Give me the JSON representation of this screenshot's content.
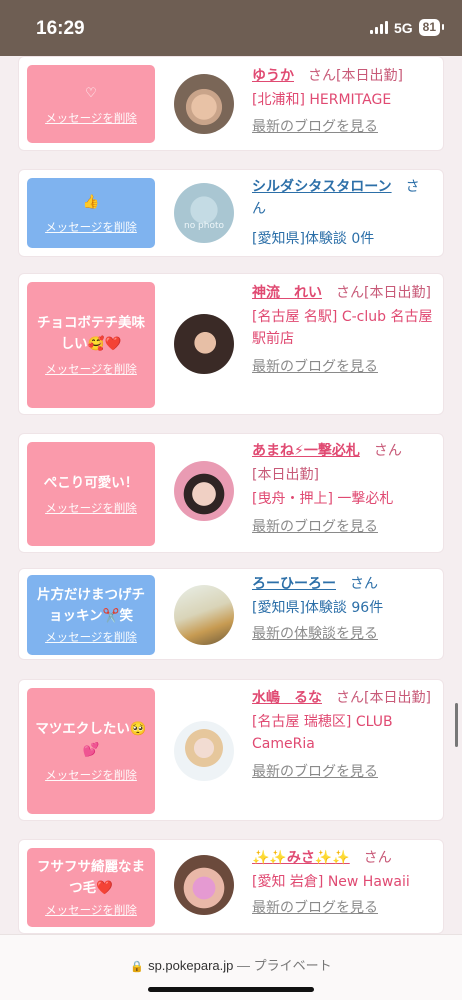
{
  "status_bar": {
    "time": "16:29",
    "network": "5G",
    "battery": "81"
  },
  "cards": [
    {
      "bubble": "",
      "delete_label": "メッセージを削除",
      "name": "ゆうか",
      "san": "さん",
      "tag": "[本日出勤]",
      "location": "[北浦和] HERMITAGE",
      "link": "最新のブログを見る"
    },
    {
      "bubble": "👍",
      "delete_label": "メッセージを削除",
      "name": "シルダシタスタローン",
      "san": "さん",
      "location": "[愛知県]体験談 0件"
    },
    {
      "bubble": "チョコボテチ美味しい🥰❤️",
      "delete_label": "メッセージを削除",
      "name": "神流　れい",
      "san": "さん",
      "tag": "[本日出勤]",
      "location": "[名古屋 名駅] C-club 名古屋駅前店",
      "link": "最新のブログを見る"
    },
    {
      "bubble": "ぺこり可愛い！",
      "delete_label": "メッセージを削除",
      "name": "あまね⚡一撃必札",
      "san": "さん",
      "tag": "[本日出勤]",
      "location": "[曳舟・押上] 一撃必札",
      "link": "最新のブログを見る"
    },
    {
      "bubble": "片方だけまつげチョッキン✂️笑",
      "delete_label": "メッセージを削除",
      "name": "ろーひーろー",
      "san": "さん",
      "location": "[愛知県]体験談 96件",
      "link": "最新の体験談を見る"
    },
    {
      "bubble": "マツエクしたい🥺💕",
      "delete_label": "メッセージを削除",
      "name": "水嶋　るな",
      "san": "さん",
      "tag": "[本日出勤]",
      "location": "[名古屋 瑞穂区] CLUB CameRia",
      "link": "最新のブログを見る"
    },
    {
      "bubble": "フサフサ綺麗なまつ毛❤️",
      "delete_label": "メッセージを削除",
      "name": "✨✨みさ✨✨",
      "san": "さん",
      "location": "[愛知 岩倉] New Hawaii",
      "link": "最新のブログを見る"
    }
  ],
  "avatar_note": "no photo",
  "url_bar": {
    "domain": "sp.pokepara.jp",
    "separator": "—",
    "mode": "プライベート"
  }
}
